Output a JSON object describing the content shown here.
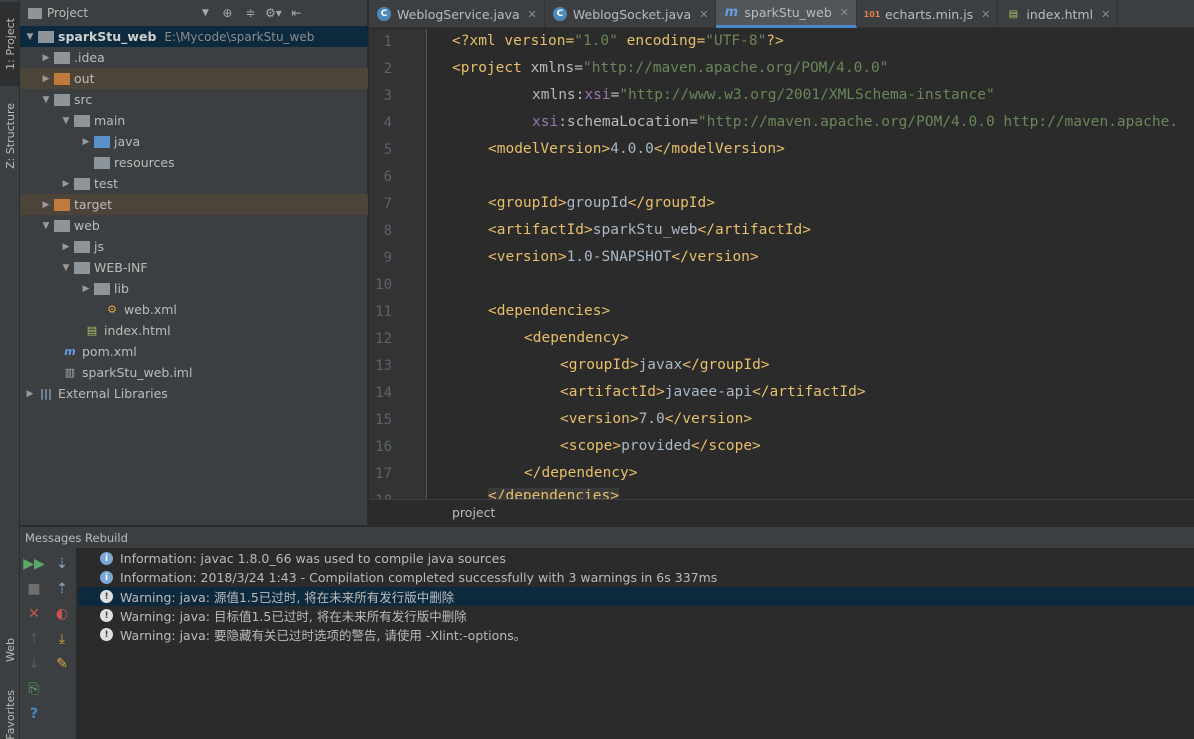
{
  "left_strip": {
    "project_tab": "1: Project",
    "structure_tab": "Z: Structure",
    "web_tab": "Web",
    "favorites_tab": "Favorites"
  },
  "project_panel": {
    "title": "Project",
    "tree": [
      {
        "label": "sparkStu_web",
        "path": "E:\\Mycode\\sparkStu_web"
      },
      {
        "label": ".idea"
      },
      {
        "label": "out"
      },
      {
        "label": "src"
      },
      {
        "label": "main"
      },
      {
        "label": "java"
      },
      {
        "label": "resources"
      },
      {
        "label": "test"
      },
      {
        "label": "target"
      },
      {
        "label": "web"
      },
      {
        "label": "js"
      },
      {
        "label": "WEB-INF"
      },
      {
        "label": "lib"
      },
      {
        "label": "web.xml"
      },
      {
        "label": "index.html"
      },
      {
        "label": "pom.xml"
      },
      {
        "label": "sparkStu_web.iml"
      },
      {
        "label": "External Libraries"
      }
    ]
  },
  "editor": {
    "tabs": [
      {
        "label": "WeblogService.java",
        "icon": "C"
      },
      {
        "label": "WeblogSocket.java",
        "icon": "C"
      },
      {
        "label": "sparkStu_web",
        "icon": "m"
      },
      {
        "label": "echarts.min.js",
        "icon": "bin"
      },
      {
        "label": "index.html",
        "icon": "H"
      }
    ],
    "line_numbers": [
      "1",
      "2",
      "3",
      "4",
      "5",
      "6",
      "7",
      "8",
      "9",
      "10",
      "11",
      "12",
      "13",
      "14",
      "15",
      "16",
      "17",
      "18"
    ],
    "breadcrumb": "project",
    "code": {
      "l1_a": "<?xml version=",
      "l1_b": "\"1.0\"",
      "l1_c": " encoding=",
      "l1_d": "\"UTF-8\"",
      "l1_e": "?>",
      "l2_tag": "<project ",
      "l2_attr": "xmlns=",
      "l2_val": "\"http://maven.apache.org/POM/4.0.0\"",
      "l3_attr": "xmlns:",
      "l3_ns": "xsi",
      "l3_eq": "=",
      "l3_val": "\"http://www.w3.org/2001/XMLSchema-instance\"",
      "l4_ns": "xsi",
      "l4_attr": ":schemaLocation=",
      "l4_val": "\"http://maven.apache.org/POM/4.0.0 http://maven.apache.",
      "l5_open": "<modelVersion>",
      "l5_txt": "4.0.0",
      "l5_close": "</modelVersion>",
      "l7_open": "<groupId>",
      "l7_txt": "groupId",
      "l7_close": "</groupId>",
      "l8_open": "<artifactId>",
      "l8_txt": "sparkStu_web",
      "l8_close": "</artifactId>",
      "l9_open": "<version>",
      "l9_txt": "1.0-SNAPSHOT",
      "l9_close": "</version>",
      "l11": "<dependencies>",
      "l12": "<dependency>",
      "l13_open": "<groupId>",
      "l13_txt": "javax",
      "l13_close": "</groupId>",
      "l14_open": "<artifactId>",
      "l14_txt": "javaee-api",
      "l14_close": "</artifactId>",
      "l15_open": "<version>",
      "l15_txt": "7.0",
      "l15_close": "</version>",
      "l16_open": "<scope>",
      "l16_txt": "provided",
      "l16_close": "</scope>",
      "l17": "</dependency>",
      "l18": "</dependencies>"
    }
  },
  "messages": {
    "header": "Messages Rebuild",
    "rows": [
      {
        "type": "info",
        "text": "Information: javac 1.8.0_66 was used to compile java sources"
      },
      {
        "type": "info",
        "text": "Information: 2018/3/24 1:43 - Compilation completed successfully with 3 warnings in 6s 337ms"
      },
      {
        "type": "warning",
        "text": "Warning: java: 源值1.5已过时, 将在未来所有发行版中删除"
      },
      {
        "type": "warning",
        "text": "Warning: java: 目标值1.5已过时, 将在未来所有发行版中删除"
      },
      {
        "type": "warning",
        "text": "Warning: java: 要隐藏有关已过时选项的警告, 请使用 -Xlint:-options。"
      }
    ]
  },
  "colors": {
    "selection": "#0d293e",
    "tag": "#e8bf6a",
    "string": "#6a8759",
    "namespace": "#9876aa"
  }
}
